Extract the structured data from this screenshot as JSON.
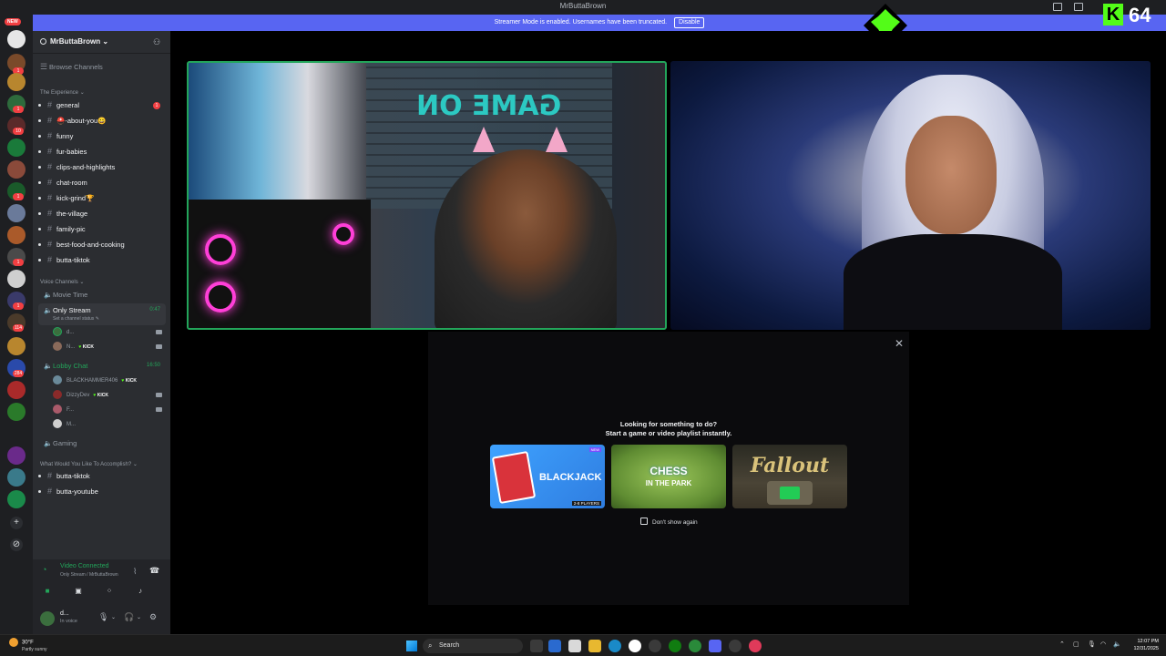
{
  "window": {
    "title": "MrButtaBrown"
  },
  "banner": {
    "text": "Streamer Mode is enabled. Usernames have been truncated.",
    "disable_label": "Disable"
  },
  "overlay": {
    "kick_count": "64"
  },
  "rail": {
    "new_label": "NEW",
    "badges": [
      "1",
      "1",
      "10",
      "1",
      "1",
      "1",
      "114",
      "284"
    ]
  },
  "server": {
    "name": "MrButtaBrown",
    "browse_channels": "Browse Channels"
  },
  "sidebar": {
    "category_experience": "The Experience",
    "text_channels": [
      {
        "name": "general",
        "unread": true,
        "badge": "1"
      },
      {
        "name": "⛑️-about-you😀",
        "unread": true
      },
      {
        "name": "funny",
        "unread": true
      },
      {
        "name": "fur-babies",
        "unread": true
      },
      {
        "name": "clips-and-highlights",
        "unread": true
      },
      {
        "name": "chat-room",
        "unread": true
      },
      {
        "name": "kick-grind🏆",
        "unread": true
      },
      {
        "name": "the-village",
        "unread": true
      },
      {
        "name": "family-pic",
        "unread": true
      },
      {
        "name": "best-food-and-cooking",
        "unread": true
      },
      {
        "name": "butta-tiktok",
        "unread": true
      }
    ],
    "category_voice": "Voice Channels",
    "voice": {
      "movie_time": "Movie Time",
      "only_stream": "Only Stream",
      "only_stream_time": "0:47",
      "only_stream_status": "Set a channel status ✎",
      "only_stream_members": [
        {
          "name": "d...",
          "kick": false
        },
        {
          "name": "N...",
          "kick": true
        }
      ],
      "lobby_chat": "Lobby Chat",
      "lobby_chat_time": "16:50",
      "lobby_members": [
        {
          "name": "BLACKHAMMER406",
          "kick": true
        },
        {
          "name": "DizzyDev",
          "kick": true
        },
        {
          "name": "F...",
          "kick": false
        },
        {
          "name": "M...",
          "kick": false
        }
      ],
      "gaming": "Gaming"
    },
    "category_accomplish": "What Would You Like To Accomplish?",
    "accomplish_channels": [
      "butta-tiktok",
      "butta-youtube"
    ],
    "kick_label": "KICK"
  },
  "voice_panel": {
    "status": "Video Connected",
    "sub": "Only Stream / MrButtaBrown"
  },
  "user_panel": {
    "name": "d...",
    "status": "In voice"
  },
  "activity_modal": {
    "line1": "Looking for something to do?",
    "line2": "Start a game or video playlist instantly.",
    "cards": [
      {
        "title": "BLACKJACK",
        "tag": "NEW",
        "players": "2-8 PLAYERS"
      },
      {
        "title": "CHESS",
        "title2": "IN THE PARK"
      },
      {
        "title": "Fallout"
      }
    ],
    "dont_show": "Don't show again"
  },
  "taskbar": {
    "weather_temp": "30°F",
    "weather_desc": "Partly sunny",
    "search": "Search",
    "time": "12:07 PM",
    "date": "12/31/2025"
  },
  "colors": {
    "accent": "#5865f2",
    "online": "#23a55a",
    "kick_green": "#53fc18",
    "mention": "#f23f42"
  }
}
